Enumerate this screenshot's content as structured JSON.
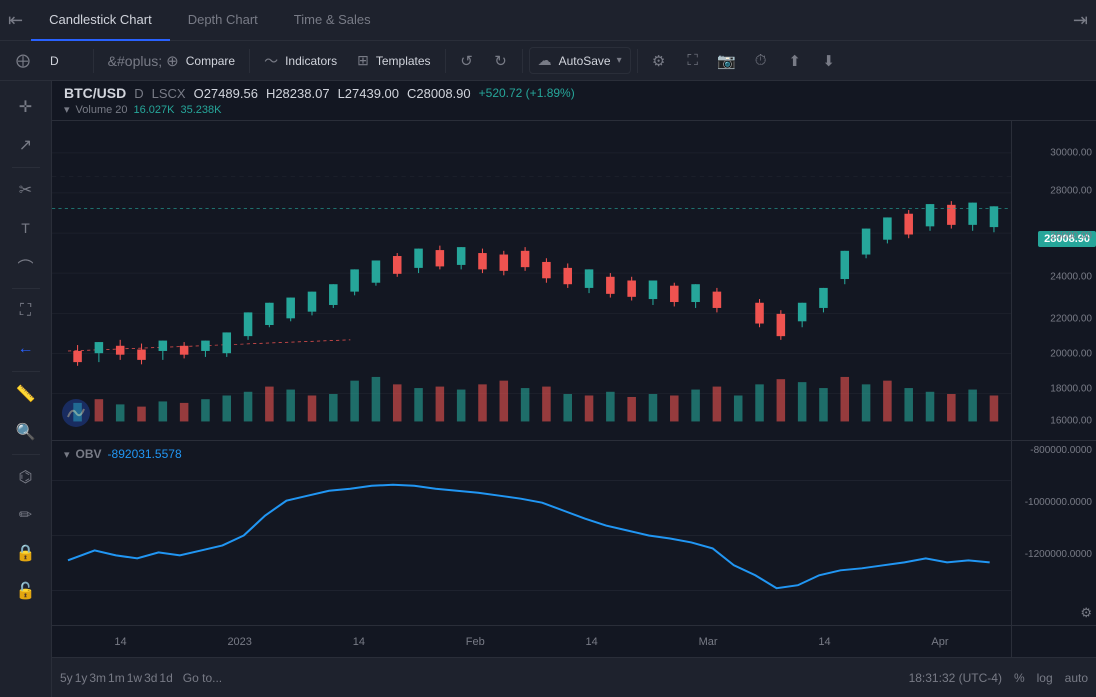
{
  "tabs": {
    "items": [
      {
        "label": "Candlestick Chart",
        "active": true
      },
      {
        "label": "Depth Chart",
        "active": false
      },
      {
        "label": "Time & Sales",
        "active": false
      }
    ]
  },
  "toolbar": {
    "timeframe": "D",
    "compare_label": "Compare",
    "indicators_label": "Indicators",
    "templates_label": "Templates",
    "autosave_label": "AutoSave"
  },
  "chart": {
    "pair": "BTC/USD",
    "timeframe": "D",
    "exchange": "LSCX",
    "open": "O27489.56",
    "high": "H28238.07",
    "low": "L27439.00",
    "close": "C28008.90",
    "change": "+520.72 (+1.89%)",
    "volume_label": "Volume 20",
    "volume_val1": "16.027K",
    "volume_val2": "35.238K",
    "current_price": "28008.90",
    "price_levels": [
      "30000.00",
      "28000.00",
      "26000.00",
      "24000.00",
      "22000.00",
      "20000.00",
      "18000.00",
      "16000.00"
    ],
    "obv_label": "OBV",
    "obv_value": "-892031.5578",
    "obv_levels": [
      "-800000.0000",
      "-1000000.0000",
      "-1200000.0000"
    ],
    "time_labels": [
      "14",
      "2023",
      "14",
      "Feb",
      "14",
      "Mar",
      "14",
      "Apr"
    ]
  },
  "bottom_bar": {
    "periods": [
      "5y",
      "1y",
      "3m",
      "1m",
      "1w",
      "3d",
      "1d"
    ],
    "goto_label": "Go to...",
    "time": "18:31:32 (UTC-4)",
    "percent_label": "%",
    "log_label": "log",
    "auto_label": "auto"
  },
  "tools": [
    "crosshair",
    "trend-line",
    "fib-retracement",
    "text",
    "path",
    "measure",
    "zoom",
    "magnet",
    "pencil",
    "lock",
    "arrow-back",
    "settings-small"
  ]
}
